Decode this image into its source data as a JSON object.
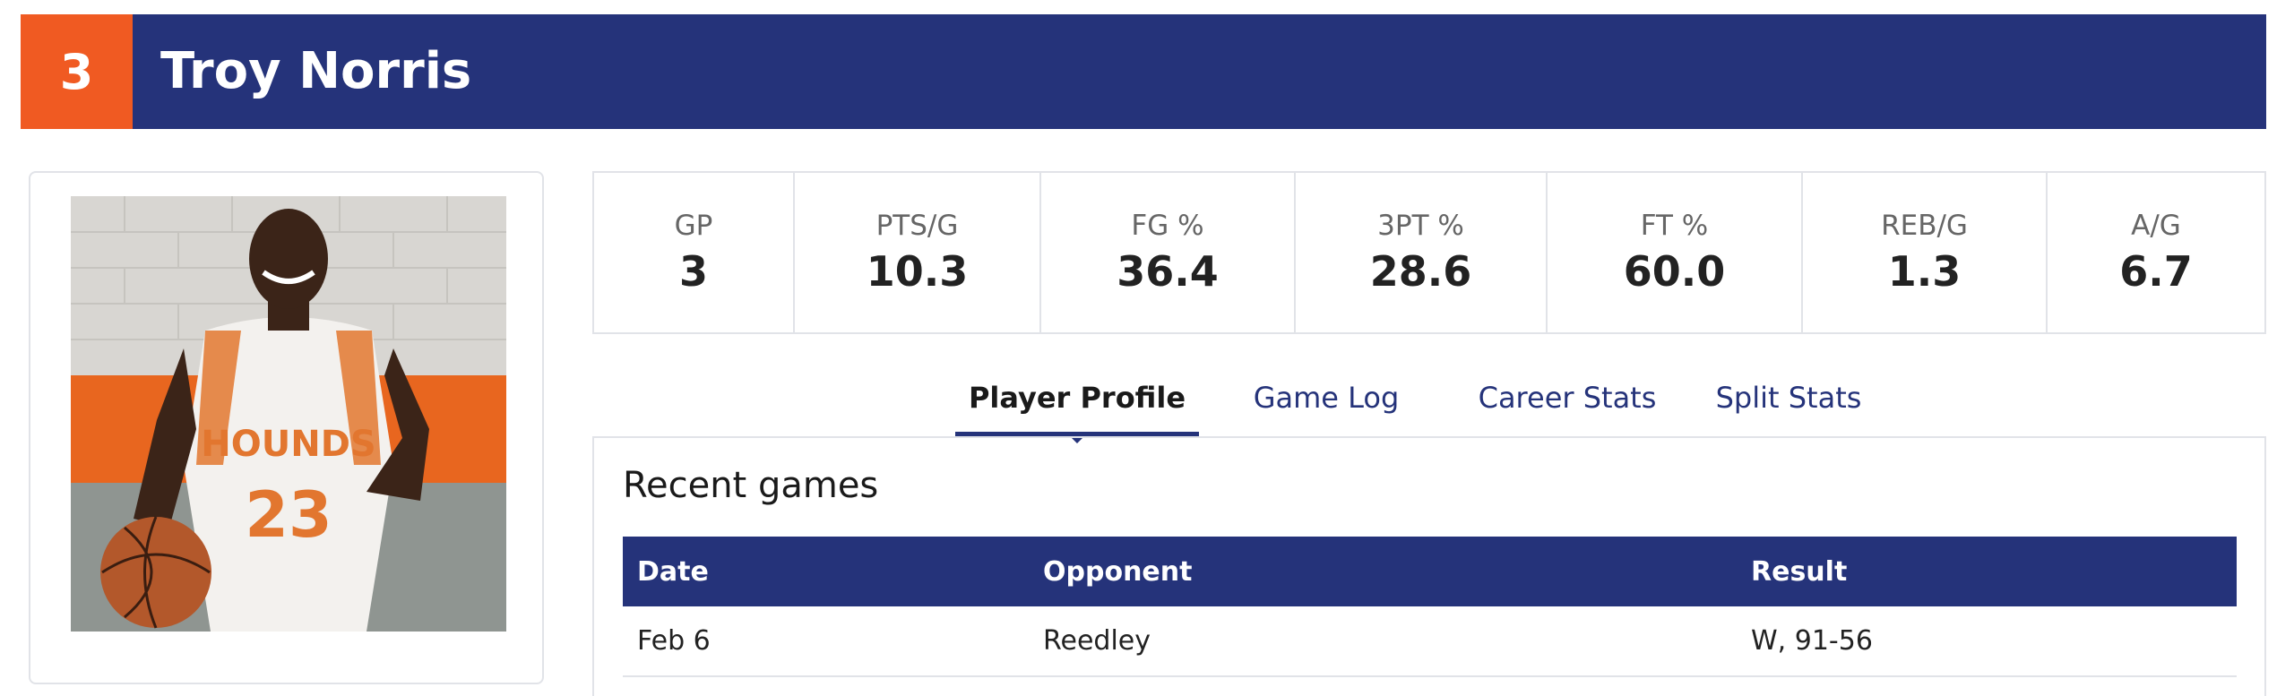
{
  "player": {
    "number": "3",
    "name": "Troy Norris"
  },
  "photo": {
    "alt": "Player photo",
    "jersey_text": "HOUNDS",
    "jersey_number": "23"
  },
  "stats": [
    {
      "label": "GP",
      "value": "3"
    },
    {
      "label": "PTS/G",
      "value": "10.3"
    },
    {
      "label": "FG %",
      "value": "36.4"
    },
    {
      "label": "3PT %",
      "value": "28.6"
    },
    {
      "label": "FT %",
      "value": "60.0"
    },
    {
      "label": "REB/G",
      "value": "1.3"
    },
    {
      "label": "A/G",
      "value": "6.7"
    }
  ],
  "tabs": [
    {
      "label": "Player Profile",
      "active": true
    },
    {
      "label": "Game Log",
      "active": false
    },
    {
      "label": "Career Stats",
      "active": false
    },
    {
      "label": "Split Stats",
      "active": false
    }
  ],
  "recent_games": {
    "title": "Recent games",
    "columns": [
      "Date",
      "Opponent",
      "Result"
    ],
    "rows": [
      [
        "Feb 6",
        "Reedley",
        "W, 91-56"
      ]
    ]
  },
  "colors": {
    "navy": "#25337a",
    "orange": "#f05a22",
    "border": "#e1e3e8"
  }
}
